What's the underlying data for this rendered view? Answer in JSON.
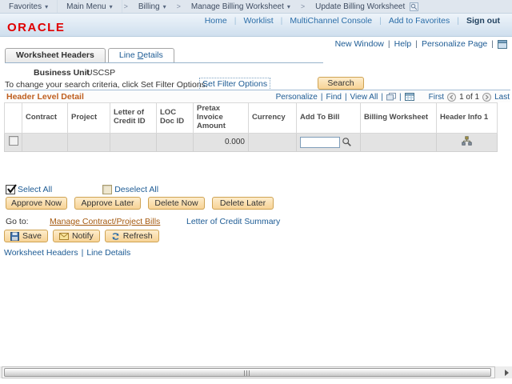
{
  "sep": "|",
  "breadcrumb": {
    "separator": ">",
    "dropdown_glyph": "▾",
    "items": [
      {
        "label": "Favorites"
      },
      {
        "label": "Main Menu"
      },
      {
        "label": "Billing"
      },
      {
        "label": "Manage Billing Worksheet"
      },
      {
        "label": "Update Billing Worksheet"
      }
    ]
  },
  "header": {
    "logo": "ORACLE",
    "links": [
      "Home",
      "Worklist",
      "MultiChannel Console",
      "Add to Favorites"
    ],
    "sign_out": "Sign out"
  },
  "page_bar": {
    "new_window": "New Window",
    "help": "Help",
    "personalize_page": "Personalize Page"
  },
  "tabs": {
    "active": "Worksheet Headers",
    "inactive_pre": "Line ",
    "inactive_key": "D",
    "inactive_post": "etails"
  },
  "business_unit": {
    "label": "Business Unit",
    "value": "USCSP"
  },
  "filter": {
    "hint": "To change your search criteria, click Set Filter Options.",
    "link": "Set Filter Options",
    "search_button": "Search"
  },
  "grid": {
    "title": "Header Level Detail",
    "controls": {
      "personalize": "Personalize",
      "find": "Find",
      "view_all": "View All",
      "first": "First",
      "position": "1 of 1",
      "last": "Last"
    },
    "columns": [
      "Contract",
      "Project",
      "Letter of Credit ID",
      "LOC Doc ID",
      "Pretax Invoice Amount",
      "Currency",
      "Add To Bill",
      "Billing Worksheet",
      "Header Info 1"
    ],
    "row": {
      "pretax_invoice_amount": "0.000",
      "add_to_bill_value": ""
    }
  },
  "selection": {
    "select_all": "Select All",
    "deselect_all": "Deselect All"
  },
  "actions": {
    "approve_now": "Approve Now",
    "approve_later": "Approve Later",
    "delete_now": "Delete Now",
    "delete_later": "Delete Later"
  },
  "goto": {
    "label": "Go to:",
    "manage_link": "Manage Contract/Project Bills",
    "loc_link": "Letter of Credit Summary"
  },
  "toolbar": {
    "save": "Save",
    "notify": "Notify",
    "refresh": "Refresh"
  },
  "footer": {
    "link1": "Worksheet Headers",
    "link2": "Line Details"
  },
  "colors": {
    "oracle_red": "#e00000",
    "link_blue": "#1d5b94",
    "accent_orange": "#bf5f1f",
    "button_tan": "#f7d396"
  }
}
